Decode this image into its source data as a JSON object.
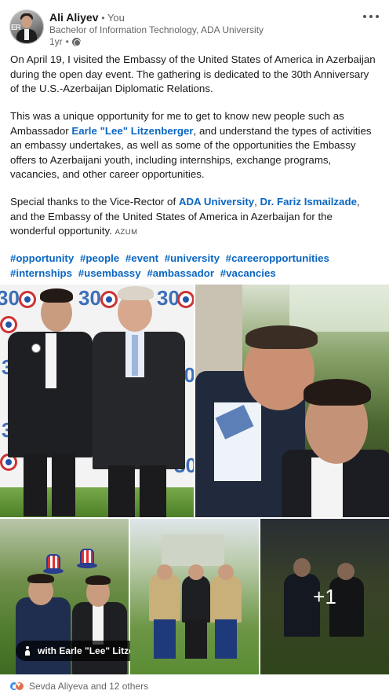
{
  "author": {
    "name": "Ali Aliyev",
    "relation": "You",
    "headline": "Bachelor of Information Technology, ADA University",
    "time": "1yr"
  },
  "post": {
    "p1": "On April 19, I visited the Embassy of the United States of America in Azerbaijan during the open day event. The gathering is dedicated to the 30th Anniversary of the U.S.-Azerbaijan Diplomatic Relations.",
    "p2_a": "This was a unique opportunity for me to get to know new people such as Ambassador ",
    "p2_link": "Earle \"Lee\" Litzenberger",
    "p2_b": ", and understand the types of activities an embassy undertakes, as well as some of the opportunities the Embassy offers to Azerbaijani youth, including internships, exchange programs, vacancies, and other career opportunities.",
    "p3_a": "Special thanks to the Vice-Rector of ",
    "p3_link1": "ADA University",
    "p3_sep": ", ",
    "p3_link2": "Dr. Fariz Ismailzade",
    "p3_b": ", and the Embassy of the United States of America in Azerbaijan for the wonderful opportunity.",
    "p3_tag": "AZUM",
    "hashtags": [
      "#opportunity",
      "#people",
      "#event",
      "#university",
      "#careeropportunities",
      "#internships",
      "#usembassy",
      "#ambassador",
      "#vacancies"
    ]
  },
  "photos": {
    "tag_caption": "with Earle \"Lee\" Litzenberger",
    "more_count": "+1",
    "banner_text": "30"
  },
  "reactions": {
    "summary": "Sevda Aliyeva and 12 others"
  }
}
